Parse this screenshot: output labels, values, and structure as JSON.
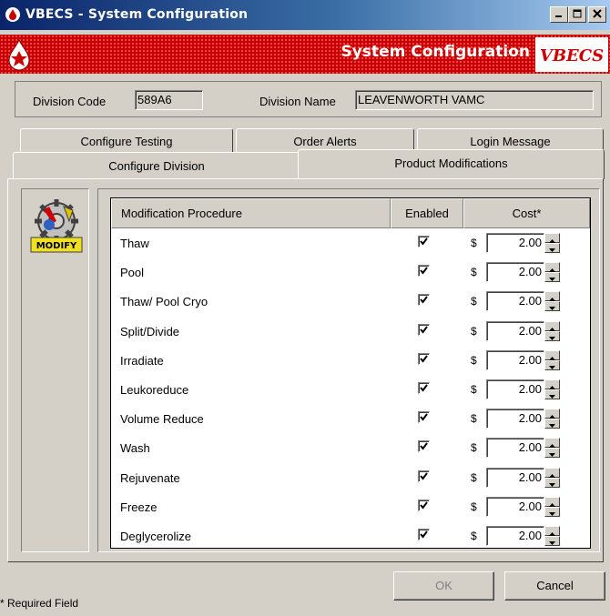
{
  "window": {
    "title": "VBECS - System Configuration"
  },
  "banner": {
    "title": "System Configuration",
    "logo": "VBECS"
  },
  "division": {
    "code_label": "Division Code",
    "code_value": "589A6",
    "name_label": "Division Name",
    "name_value": "LEAVENWORTH VAMC"
  },
  "tabs_top": [
    {
      "label": "Configure Testing"
    },
    {
      "label": "Order Alerts"
    },
    {
      "label": "Login Message"
    }
  ],
  "tabs_bottom": [
    {
      "label": "Configure Division"
    },
    {
      "label": "Product Modifications",
      "active": true
    }
  ],
  "side_icon": {
    "label": "MODIFY",
    "icon": "modify-icon"
  },
  "grid": {
    "headers": {
      "procedure": "Modification Procedure",
      "enabled": "Enabled",
      "cost": "Cost*"
    },
    "currency": "$",
    "rows": [
      {
        "name": "Thaw",
        "enabled": true,
        "cost": "2.00"
      },
      {
        "name": "Pool",
        "enabled": true,
        "cost": "2.00"
      },
      {
        "name": "Thaw/ Pool Cryo",
        "enabled": true,
        "cost": "2.00"
      },
      {
        "name": "Split/Divide",
        "enabled": true,
        "cost": "2.00"
      },
      {
        "name": "Irradiate",
        "enabled": true,
        "cost": "2.00"
      },
      {
        "name": "Leukoreduce",
        "enabled": true,
        "cost": "2.00"
      },
      {
        "name": "Volume Reduce",
        "enabled": true,
        "cost": "2.00"
      },
      {
        "name": "Wash",
        "enabled": true,
        "cost": "2.00"
      },
      {
        "name": "Rejuvenate",
        "enabled": true,
        "cost": "2.00"
      },
      {
        "name": "Freeze",
        "enabled": true,
        "cost": "2.00"
      },
      {
        "name": "Deglycerolize",
        "enabled": true,
        "cost": "2.00"
      }
    ]
  },
  "buttons": {
    "ok": "OK",
    "cancel": "Cancel"
  },
  "footer": {
    "required_note": "* Required Field"
  },
  "colors": {
    "titlebar": "#0a246a",
    "banner": "#cc0000",
    "face": "#d4d0c8"
  }
}
